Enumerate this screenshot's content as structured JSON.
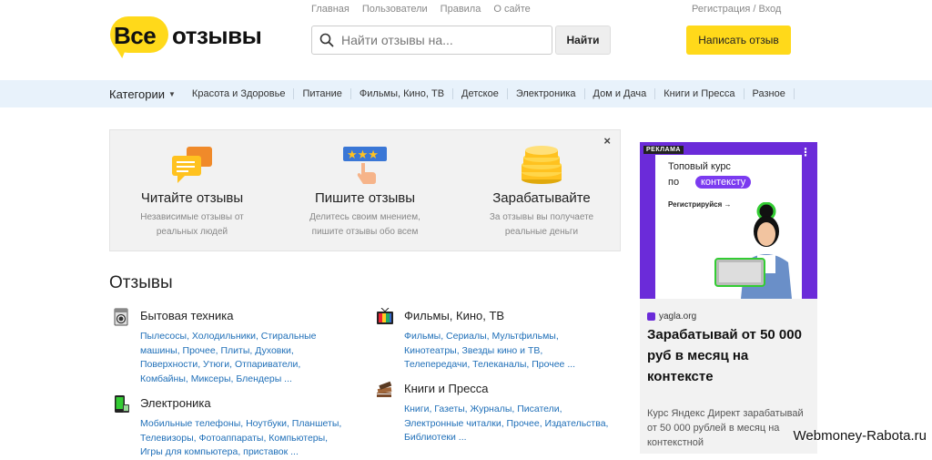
{
  "header": {
    "logo_vse": "Все",
    "logo_otzyvy": "отзывы",
    "nav": [
      "Главная",
      "Пользователи",
      "Правила",
      "О сайте"
    ],
    "auth": "Регистрация / Вход",
    "search_placeholder": "Найти отзывы на...",
    "search_button": "Найти",
    "write_button": "Написать отзыв"
  },
  "categories_bar": {
    "label": "Категории",
    "items": [
      "Красота и Здоровье",
      "Питание",
      "Фильмы, Кино, ТВ",
      "Детское",
      "Электроника",
      "Дом и Дача",
      "Книги и Прессa",
      "Разное"
    ]
  },
  "promo": {
    "close": "×",
    "columns": [
      {
        "title": "Читайте отзывы",
        "desc": "Независимые отзывы от реальных людей"
      },
      {
        "title": "Пишите отзывы",
        "desc": "Делитесь своим мнением, пишите отзывы обо всем"
      },
      {
        "title": "Зарабатывайте",
        "desc": "За отзывы вы получаете реальные деньги"
      }
    ]
  },
  "reviews": {
    "heading": "Отзывы",
    "categories": [
      {
        "title": "Бытовая техника",
        "links": "Пылесосы, Холодильники, Стиральные машины, Прочее, Плиты, Духовки, Поверхности, Утюги, Отпариватели, Комбайны, Миксеры, Блендеры ...",
        "icon": "washing-machine-icon"
      },
      {
        "title": "Фильмы, Кино, ТВ",
        "links": "Фильмы, Сериалы, Мультфильмы, Кинотеатры, Звезды кино и ТВ, Телепередачи, Телеканалы, Прочее ...",
        "icon": "tv-icon"
      },
      {
        "title": "Электроника",
        "links": "Мобильные телефоны, Ноутбуки, Планшеты, Телевизоры, Фотоаппараты, Компьютеры, Игры для компьютера, приставок ...",
        "icon": "phone-icon"
      },
      {
        "title": "Книги и Пресса",
        "links": "Книги, Газеты, Журналы, Писатели, Электронные читалки, Прочее, Издательства, Библиотеки ...",
        "icon": "books-icon"
      }
    ]
  },
  "ad": {
    "label": "РЕКЛАМА",
    "creative_line1": "Топовый курс",
    "creative_line2": "по",
    "creative_pill": "контексту",
    "creative_cta": "Регистрируйся →",
    "domain": "yagla.org",
    "headline": "Зарабатывай от 50 000 руб в месяц на контексте",
    "body": "Курс Яндекс Директ зарабатывай от 50 000 рублей в месяц на контекстной"
  },
  "watermark": "Webmoney-Rabota.ru",
  "colors": {
    "brand_yellow": "#ffd91a",
    "category_bar": "#e8f2fb",
    "link": "#1f6fb8",
    "ad_purple": "#6b2bd9"
  }
}
